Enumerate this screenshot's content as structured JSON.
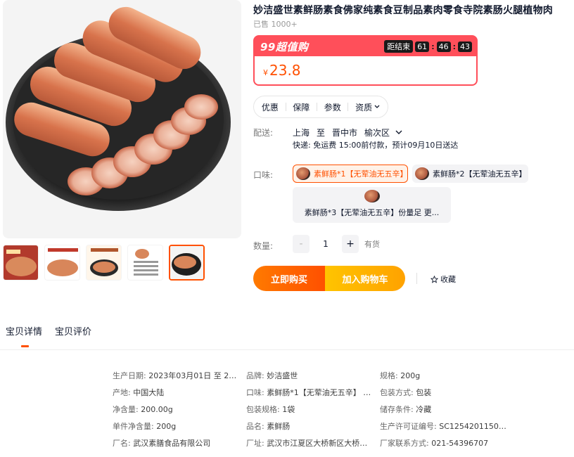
{
  "product": {
    "title": "妙洁盛世素鲜肠素食佛家纯素食豆制品素肉零食寺院素肠火腿植物肉",
    "sold": "已售 1000+"
  },
  "promo": {
    "label": "99超值购",
    "countdown_label": "距结束",
    "hours": "61",
    "minutes": "46",
    "seconds": "43",
    "price_symbol": "¥",
    "price": "23.8",
    "accent_color": "#ff4f5a"
  },
  "info_tabs": [
    "优惠",
    "保障",
    "参数",
    "资质"
  ],
  "delivery": {
    "label": "配送:",
    "from": "上海",
    "to_word": "至",
    "city": "晋中市",
    "district": "榆次区",
    "detail": "快递: 免运费  15:00前付款，预计09月10日送达"
  },
  "flavor": {
    "label": "口味:",
    "options": [
      "素鲜肠*1【无荤油无五辛】",
      "素鲜肠*2【无荤油无五辛】",
      "素鲜肠*3【无荤油无五辛】份量足 更..."
    ]
  },
  "quantity": {
    "label": "数量:",
    "minus": "-",
    "value": "1",
    "plus": "+",
    "stock": "有货"
  },
  "actions": {
    "buy": "立即购买",
    "cart": "加入购物车",
    "favorite": "收藏"
  },
  "detail_tabs": [
    "宝贝详情",
    "宝贝评价"
  ],
  "attributes": [
    {
      "k": "生产日期:",
      "v": "2023年03月01日 至 202..."
    },
    {
      "k": "品牌:",
      "v": "妙洁盛世"
    },
    {
      "k": "规格:",
      "v": "200g"
    },
    {
      "k": "产地:",
      "v": "中国大陆"
    },
    {
      "k": "口味:",
      "v": "素鲜肠*1【无荤油无五辛】 素..."
    },
    {
      "k": "包装方式:",
      "v": "包装"
    },
    {
      "k": "净含量:",
      "v": "200.00g"
    },
    {
      "k": "包装规格:",
      "v": "1袋"
    },
    {
      "k": "储存条件:",
      "v": "冷藏"
    },
    {
      "k": "单件净含量:",
      "v": "200g"
    },
    {
      "k": "品名:",
      "v": "素鲜肠"
    },
    {
      "k": "生产许可证编号:",
      "v": "SC125420115072..."
    },
    {
      "k": "厂名:",
      "v": "武汉素膳食品有限公司"
    },
    {
      "k": "厂址:",
      "v": "武汉市江夏区大桥新区大桥村..."
    },
    {
      "k": "厂家联系方式:",
      "v": "021-54396707"
    }
  ]
}
